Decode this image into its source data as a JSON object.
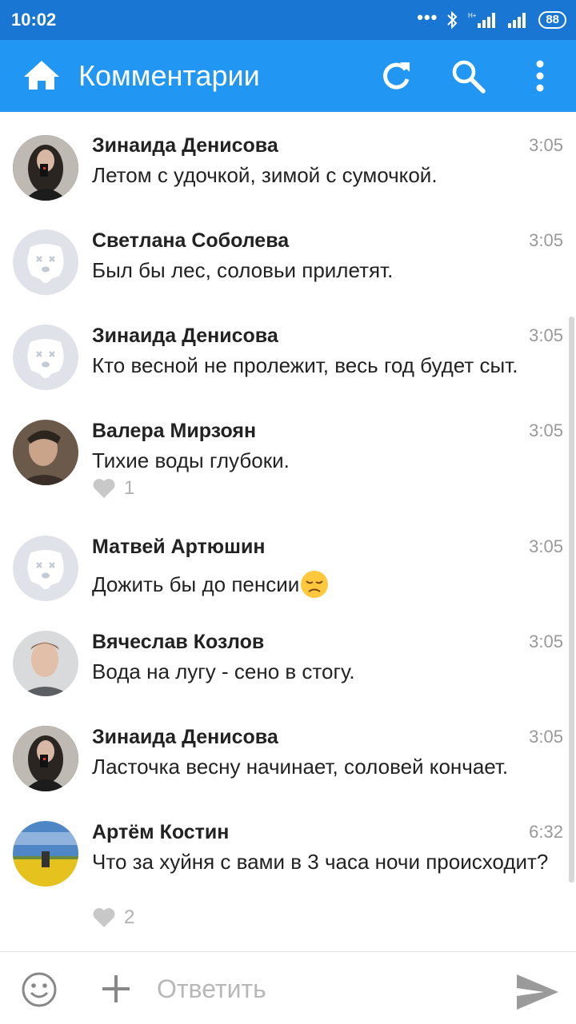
{
  "status_bar": {
    "time": "10:02",
    "dots": "•••",
    "battery": "88"
  },
  "app_bar": {
    "title": "Комментарии"
  },
  "comments": [
    {
      "author": "Зинаида Денисова",
      "time": "3:05",
      "text": "Летом с удочкой, зимой с сумочкой.",
      "avatar": "photo-woman"
    },
    {
      "author": "Светлана Соболева",
      "time": "3:05",
      "text": "Был бы лес, соловьи прилетят.",
      "avatar": "default-dog"
    },
    {
      "author": "Зинаида Денисова",
      "time": "3:05",
      "text": "Кто весной не пролежит, весь год будет сыт.",
      "avatar": "default-dog"
    },
    {
      "author": "Валера Мирзоян",
      "time": "3:05",
      "text": "Тихие воды глубоки.",
      "likes": "1",
      "avatar": "photo-man-dark"
    },
    {
      "author": "Матвей Артюшин",
      "time": "3:05",
      "text": "Дожить бы до пенсии",
      "emoji": "pensive-face",
      "avatar": "default-dog"
    },
    {
      "author": "Вячеслав Козлов",
      "time": "3:05",
      "text": "Вода на лугу - сено в стогу.",
      "avatar": "photo-man-light"
    },
    {
      "author": "Зинаида Денисова",
      "time": "3:05",
      "text": "Ласточка весну начинает, соловей кончает.",
      "avatar": "photo-woman"
    },
    {
      "author": "Артём Костин",
      "time": "6:32",
      "text": "Что за хуйня с вами в 3 часа ночи происходит?",
      "likes": "2",
      "avatar": "photo-field"
    }
  ],
  "reply": {
    "placeholder": "Ответить",
    "value": ""
  },
  "colors": {
    "status_bar": "#1976d2",
    "app_bar": "#2196f3",
    "name": "#222222",
    "time": "#999999",
    "like": "#b0b0b0",
    "placeholder": "#b8b8b8"
  }
}
